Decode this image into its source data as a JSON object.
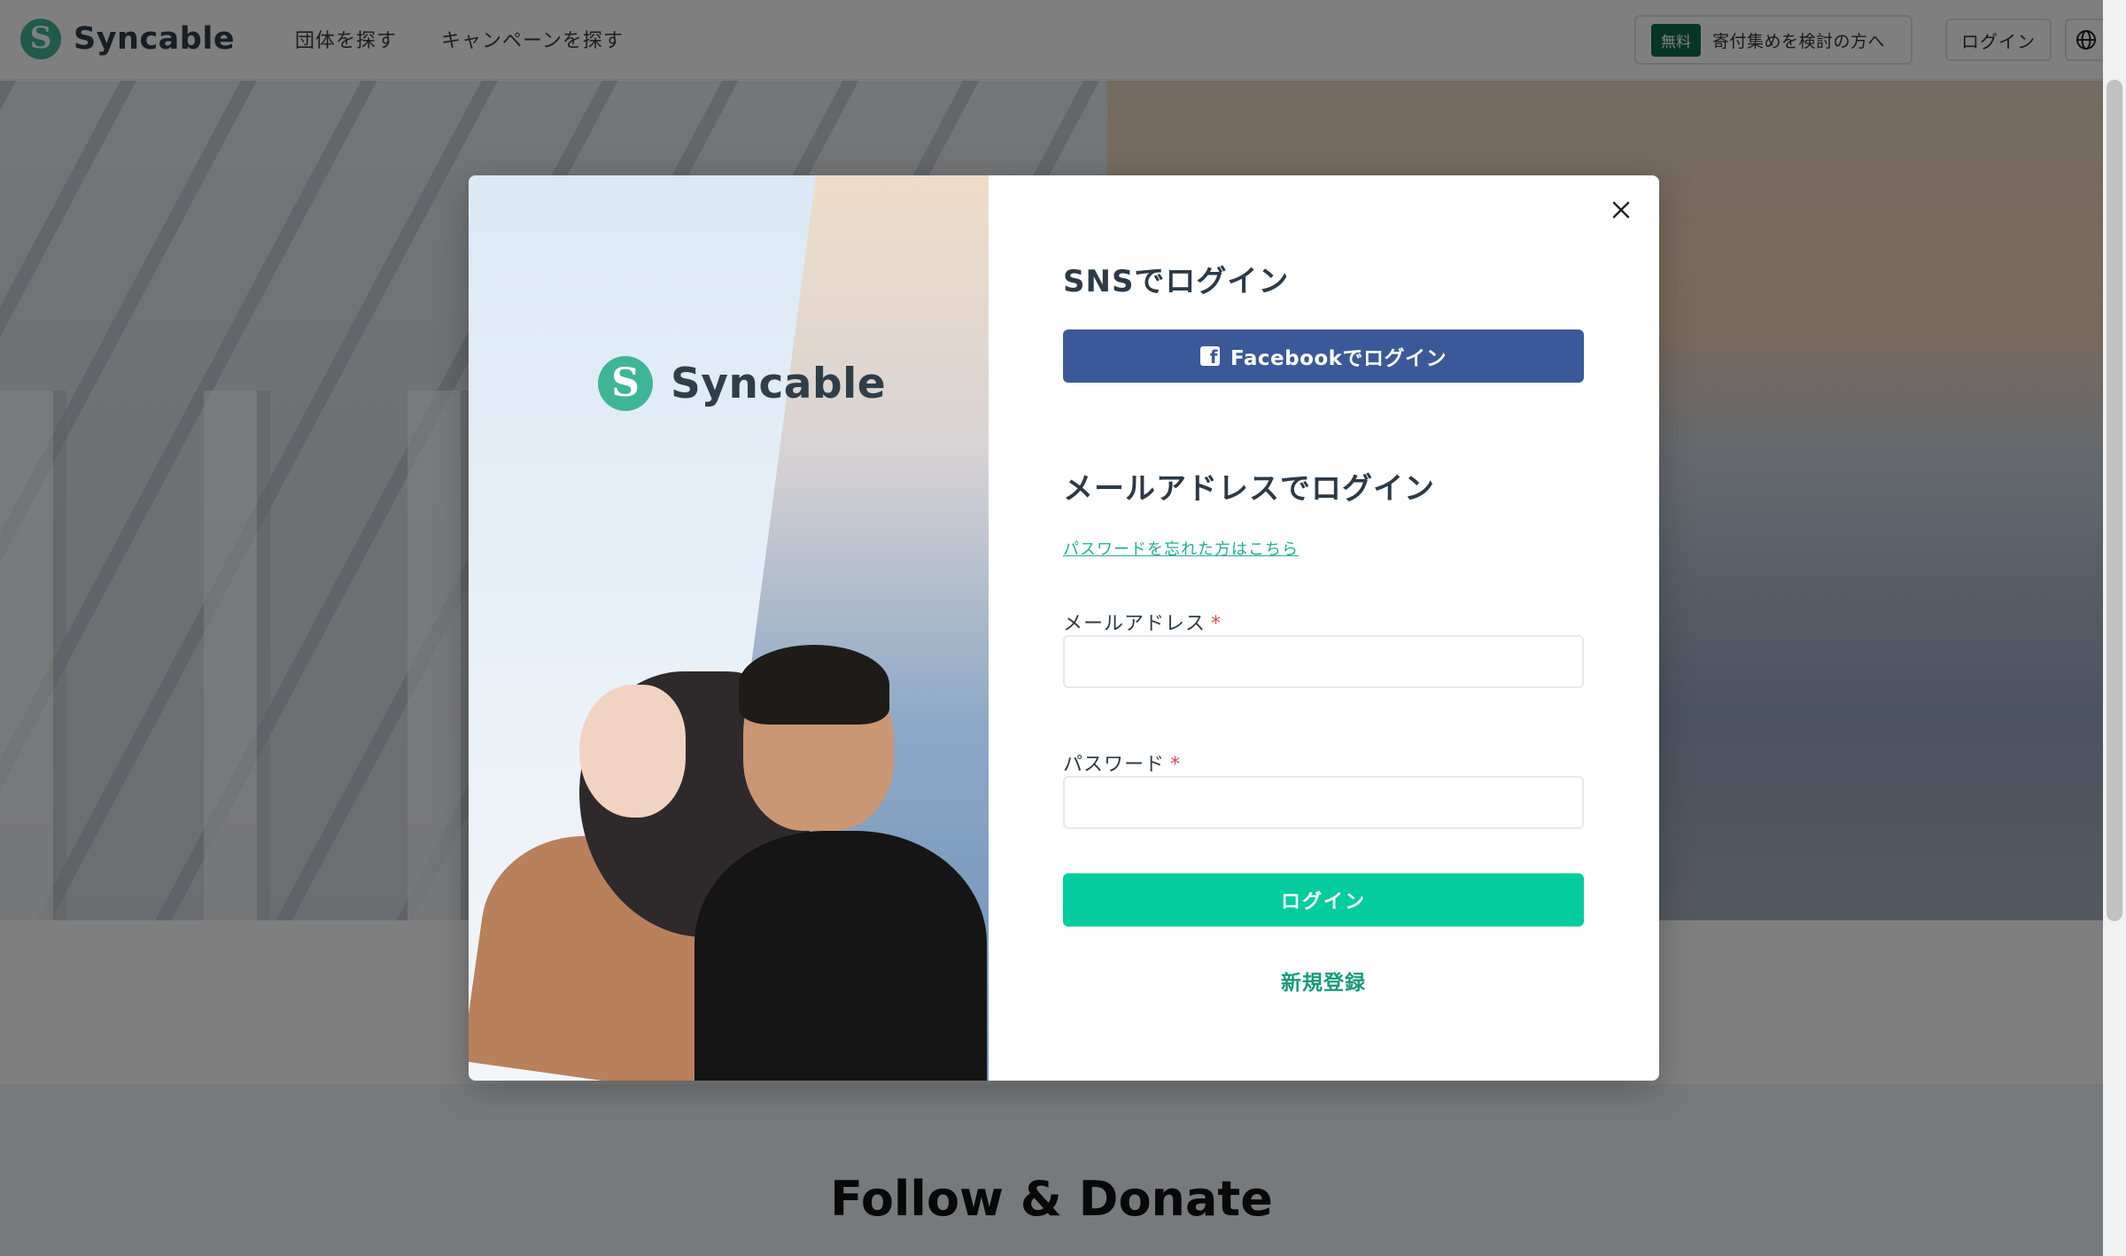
{
  "header": {
    "logo_text": "Syncable",
    "nav": [
      "団体を探す",
      "キャンペーンを探す"
    ],
    "free_badge": "無料",
    "free_cta_label": "寄付集めを検討の方へ",
    "login_label": "ログイン",
    "globe_icon": "globe-icon"
  },
  "page": {
    "follow_title": "Follow & Donate"
  },
  "modal": {
    "logo_text": "Syncable",
    "close_icon": "close-icon",
    "sns_title": "SNSでログイン",
    "facebook_button": "Facebookでログイン",
    "mail_title": "メールアドレスでログイン",
    "forgot_password": "パスワードを忘れた方はこちら",
    "email_label": "メールアドレス",
    "email_value": "",
    "password_label": "パスワード",
    "password_value": "",
    "required_mark": "*",
    "login_button": "ログイン",
    "signup_link": "新規登録"
  },
  "colors": {
    "brand": "#3fb597",
    "facebook": "#3b5998",
    "primary_button": "#05cc9e",
    "link": "#22b08e",
    "required": "#e04848"
  }
}
